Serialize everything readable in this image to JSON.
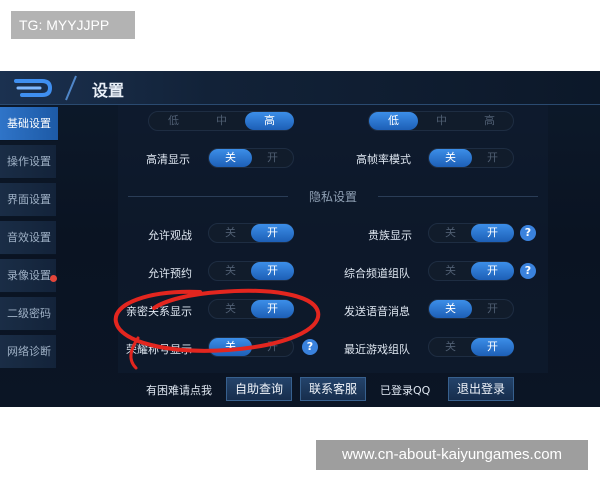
{
  "watermark_top": "TG: MYYJJPP",
  "watermark_bottom": "www.cn-about-kaiyungames.com",
  "header": {
    "title": "设置"
  },
  "sidebar": {
    "items": [
      {
        "label": "基础设置"
      },
      {
        "label": "操作设置"
      },
      {
        "label": "界面设置"
      },
      {
        "label": "音效设置"
      },
      {
        "label": "录像设置"
      },
      {
        "label": "二级密码"
      },
      {
        "label": "网络诊断"
      }
    ]
  },
  "quality_left": {
    "options": [
      "低",
      "中",
      "高"
    ],
    "selected": "高"
  },
  "quality_right": {
    "options": [
      "低",
      "中",
      "高"
    ],
    "selected": "低"
  },
  "toggle": {
    "off": "关",
    "on": "开"
  },
  "hd_display": {
    "label": "高清显示",
    "value": "关"
  },
  "high_fps": {
    "label": "高帧率模式",
    "value": "关"
  },
  "privacy": {
    "section_title": "隐私设置"
  },
  "allow_spectate": {
    "label": "允许观战",
    "value": "开"
  },
  "noble_display": {
    "label": "贵族显示",
    "value": "开"
  },
  "allow_reserve": {
    "label": "允许预约",
    "value": "开"
  },
  "channel_team": {
    "label": "综合频道组队",
    "value": "开"
  },
  "intimate_display": {
    "label": "亲密关系显示",
    "value": "开"
  },
  "voice_message": {
    "label": "发送语音消息",
    "value": "关"
  },
  "honor_display": {
    "label": "荣耀称号显示",
    "value": "关"
  },
  "recent_team": {
    "label": "最近游戏组队",
    "value": "开"
  },
  "help_icon": "?",
  "footer": {
    "trouble_label": "有困难请点我",
    "self_help_button": "自助查询",
    "contact_button": "联系客服",
    "login_status": "已登录QQ",
    "logout_button": "退出登录"
  }
}
